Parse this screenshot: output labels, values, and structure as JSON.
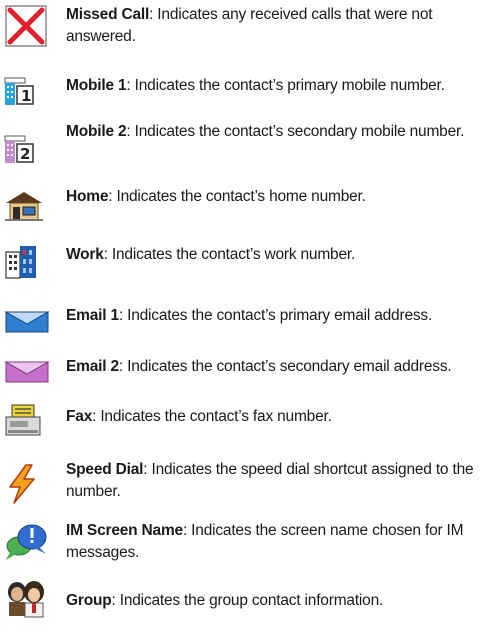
{
  "items": [
    {
      "term": "Missed Call",
      "desc": ": Indicates any received calls that were not answered.",
      "icon": "missed-call-icon"
    },
    {
      "term": "Mobile 1",
      "desc": ": Indicates the contact’s primary mobile number.",
      "icon": "mobile-1-icon"
    },
    {
      "term": "Mobile 2",
      "desc": ": Indicates the contact’s secondary mobile number.",
      "icon": "mobile-2-icon"
    },
    {
      "term": "Home",
      "desc": ": Indicates the contact’s home number.",
      "icon": "home-icon"
    },
    {
      "term": "Work",
      "desc": ": Indicates the contact’s work number.",
      "icon": "work-icon"
    },
    {
      "term": "Email 1",
      "desc": ": Indicates the contact’s primary email address.",
      "icon": "email-1-icon"
    },
    {
      "term": "Email 2",
      "desc": ": Indicates the contact’s secondary email address.",
      "icon": "email-2-icon"
    },
    {
      "term": "Fax",
      "desc": ": Indicates the contact’s fax number.",
      "icon": "fax-icon"
    },
    {
      "term": "Speed Dial",
      "desc": ": Indicates the speed dial shortcut assigned to the number.",
      "icon": "speed-dial-icon"
    },
    {
      "term": "IM Screen Name",
      "desc": ": Indicates the screen name chosen for IM messages.",
      "icon": "im-screen-name-icon"
    },
    {
      "term": "Group",
      "desc": ": Indicates the group contact information.",
      "icon": "group-icon"
    }
  ],
  "icon_labels": {
    "mobile_1": "1",
    "mobile_2": "2"
  }
}
